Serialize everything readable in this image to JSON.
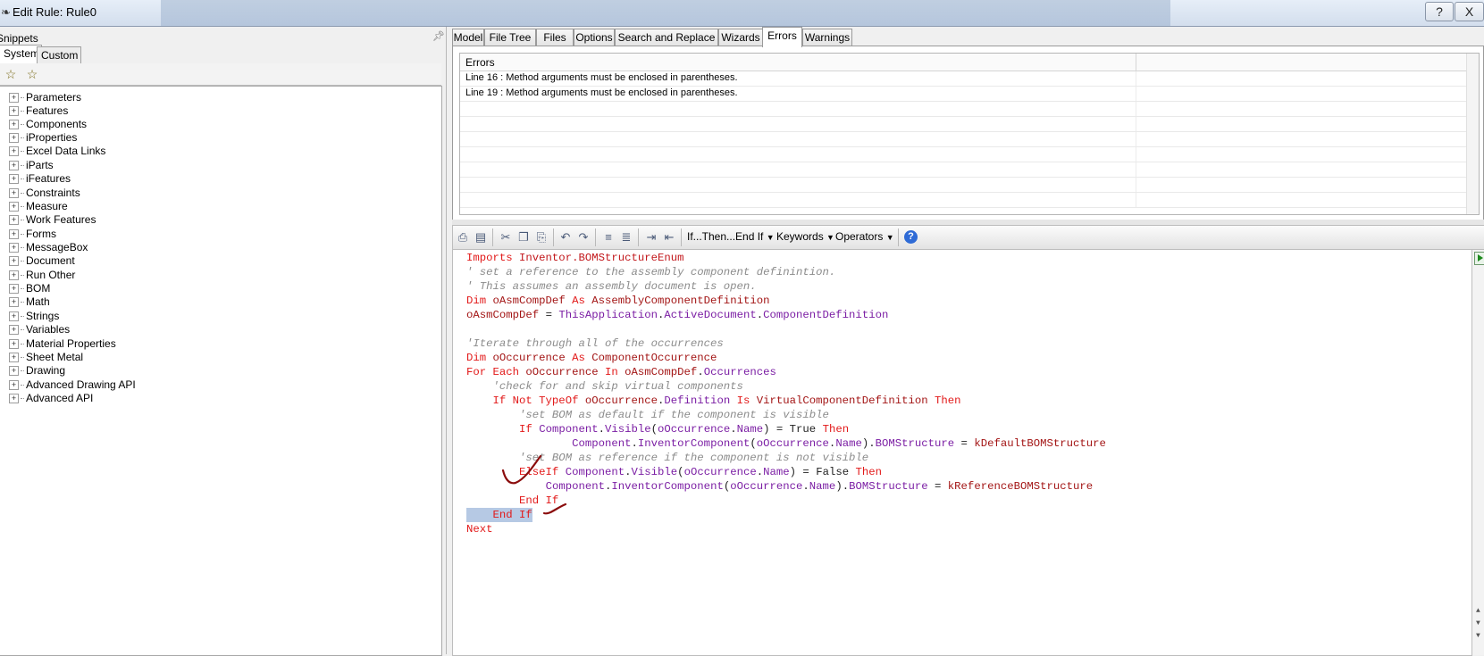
{
  "window": {
    "title": "Edit Rule: Rule0",
    "minimize_glyph": "?",
    "close_glyph": "X"
  },
  "snippets": {
    "label": "Snippets",
    "tabs": [
      "System",
      "Custom"
    ],
    "items": [
      "Parameters",
      "Features",
      "Components",
      "iProperties",
      "Excel Data Links",
      "iParts",
      "iFeatures",
      "Constraints",
      "Measure",
      "Work Features",
      "Forms",
      "MessageBox",
      "Document",
      "Run Other",
      "BOM",
      "Math",
      "Strings",
      "Variables",
      "Material Properties",
      "Sheet Metal",
      "Drawing",
      "Advanced Drawing API",
      "Advanced API"
    ]
  },
  "tabs": [
    "Model",
    "File Tree",
    "Files",
    "Options",
    "Search and Replace",
    "Wizards",
    "Errors",
    "Warnings"
  ],
  "active_tab": "Errors",
  "errors": {
    "header": "Errors",
    "rows": [
      "Line 16 : Method arguments must be enclosed in parentheses.",
      "Line 19 : Method arguments must be enclosed in parentheses."
    ]
  },
  "toolbar": {
    "ifthen": "If...Then...End If",
    "keywords": "Keywords",
    "operators": "Operators",
    "help": "?"
  },
  "code": {
    "l1a": "Imports",
    "l1b": " Inventor.BOMStructureEnum",
    "l2": "' set a reference to the assembly component definintion.",
    "l3": "' This assumes an assembly document is open.",
    "l4a": "Dim",
    "l4b": " oAsmCompDef ",
    "l4c": "As",
    "l4d": " AssemblyComponentDefinition",
    "l5a": "oAsmCompDef",
    "l5b": " = ",
    "l5c": "ThisApplication",
    "l5d": ".",
    "l5e": "ActiveDocument",
    "l5f": ".",
    "l5g": "ComponentDefinition",
    "l7": "'Iterate through all of the occurrences",
    "l8a": "Dim",
    "l8b": " oOccurrence ",
    "l8c": "As",
    "l8d": " ComponentOccurrence",
    "l9a": "For Each",
    "l9b": " oOccurrence ",
    "l9c": "In",
    "l9d": " oAsmCompDef",
    "l9e": ".",
    "l9f": "Occurrences",
    "l10": "    'check for and skip virtual components",
    "l11a": "    If Not TypeOf",
    "l11b": " oOccurrence",
    "l11c": ".",
    "l11d": "Definition",
    "l11e": " Is ",
    "l11f": "VirtualComponentDefinition",
    "l11g": " Then",
    "l12": "        'set BOM as default if the component is visible",
    "l13a": "        If ",
    "l13b": "Component",
    "l13c": ".",
    "l13d": "Visible",
    "l13e": "(",
    "l13f": "oOccurrence",
    "l13g": ".",
    "l13h": "Name",
    "l13i": ") = True ",
    "l13j": "Then",
    "l14a": "                ",
    "l14b": "Component",
    "l14c": ".",
    "l14d": "InventorComponent",
    "l14e": "(",
    "l14f": "oOccurrence",
    "l14g": ".",
    "l14h": "Name",
    "l14i": ").",
    "l14j": "BOMStructure",
    "l14k": " = ",
    "l14l": "kDefaultBOMStructure",
    "l15": "        'set BOM as reference if the component is not visible",
    "l16a": "        ElseIf ",
    "l16b": "Component",
    "l16c": ".",
    "l16d": "Visible",
    "l16e": "(",
    "l16f": "oOccurrence",
    "l16g": ".",
    "l16h": "Name",
    "l16i": ") = False ",
    "l16j": "Then",
    "l17a": "            ",
    "l17b": "Component",
    "l17c": ".",
    "l17d": "InventorComponent",
    "l17e": "(",
    "l17f": "oOccurrence",
    "l17g": ".",
    "l17h": "Name",
    "l17i": ").",
    "l17j": "BOMStructure",
    "l17k": " = ",
    "l17l": "kReferenceBOMStructure",
    "l18": "        End If",
    "l19": "    End If",
    "l20": "Next"
  },
  "colors": {
    "keyword": "#e21919",
    "comment": "#8c8c8c",
    "property": "#7b1ea4",
    "selection": "#b6c9e4",
    "annotation_ink": "#8b0d0d"
  }
}
